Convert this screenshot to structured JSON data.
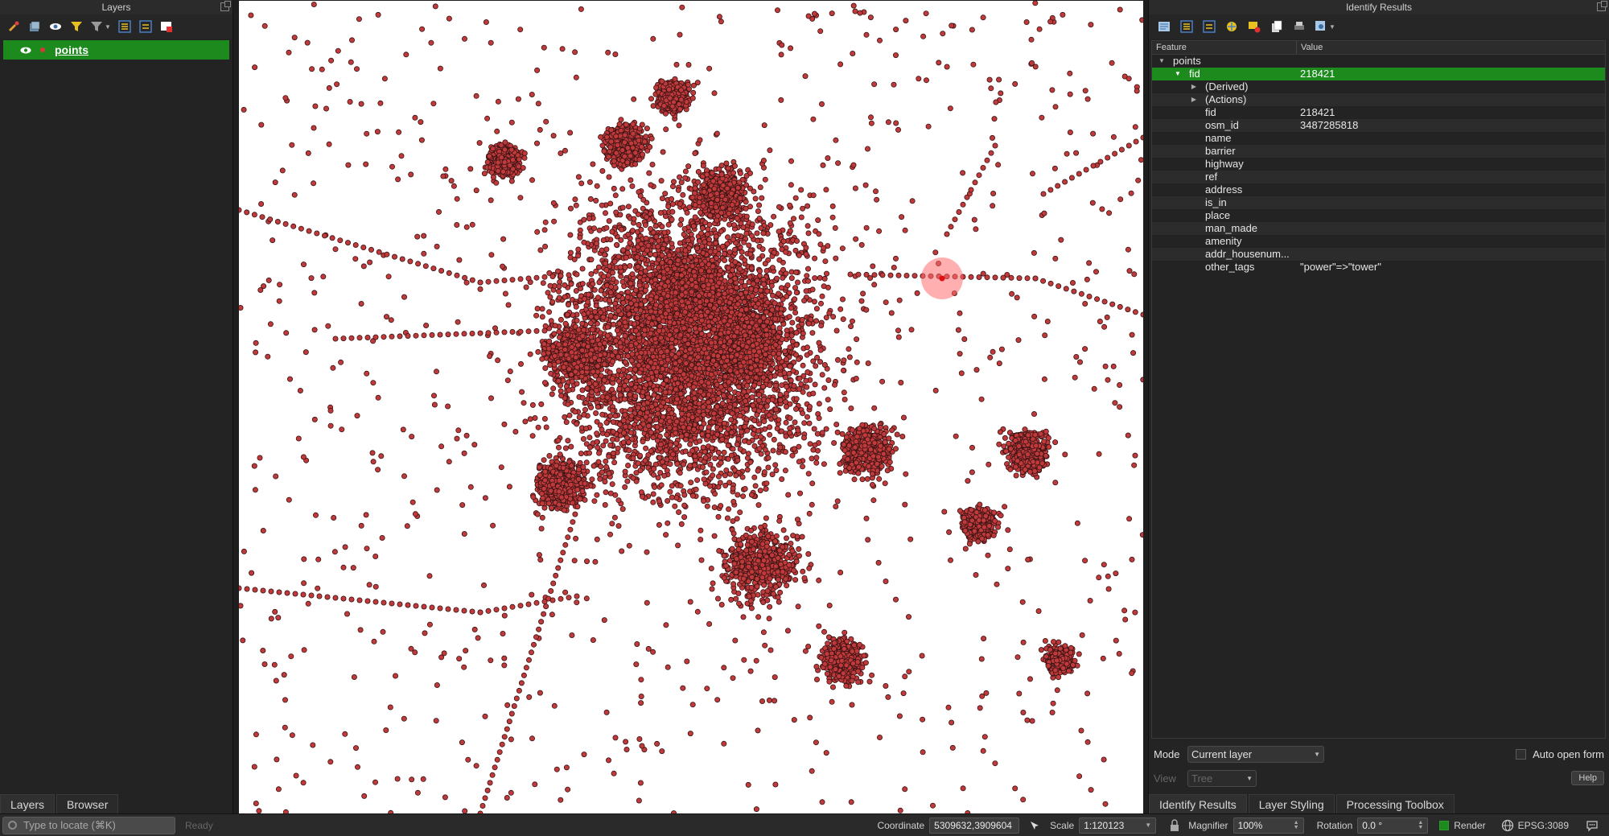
{
  "layers_panel": {
    "title": "Layers",
    "layers": [
      {
        "name": "points",
        "visible": true,
        "selected": true
      }
    ],
    "tabs": [
      "Layers",
      "Browser"
    ]
  },
  "identify_panel": {
    "title": "Identify Results",
    "header": {
      "feature": "Feature",
      "value": "Value"
    },
    "rows": [
      {
        "label": "points",
        "value": "",
        "indent": 1,
        "arrow": "down",
        "selected": false
      },
      {
        "label": "fid",
        "value": "218421",
        "indent": 2,
        "arrow": "down",
        "selected": true
      },
      {
        "label": "(Derived)",
        "value": "",
        "indent": 3,
        "arrow": "right",
        "selected": false
      },
      {
        "label": "(Actions)",
        "value": "",
        "indent": 3,
        "arrow": "right",
        "selected": false
      },
      {
        "label": "fid",
        "value": "218421",
        "indent": 3,
        "arrow": "",
        "selected": false
      },
      {
        "label": "osm_id",
        "value": "3487285818",
        "indent": 3,
        "arrow": "",
        "selected": false
      },
      {
        "label": "name",
        "value": "",
        "indent": 3,
        "arrow": "",
        "selected": false
      },
      {
        "label": "barrier",
        "value": "",
        "indent": 3,
        "arrow": "",
        "selected": false
      },
      {
        "label": "highway",
        "value": "",
        "indent": 3,
        "arrow": "",
        "selected": false
      },
      {
        "label": "ref",
        "value": "",
        "indent": 3,
        "arrow": "",
        "selected": false
      },
      {
        "label": "address",
        "value": "",
        "indent": 3,
        "arrow": "",
        "selected": false
      },
      {
        "label": "is_in",
        "value": "",
        "indent": 3,
        "arrow": "",
        "selected": false
      },
      {
        "label": "place",
        "value": "",
        "indent": 3,
        "arrow": "",
        "selected": false
      },
      {
        "label": "man_made",
        "value": "",
        "indent": 3,
        "arrow": "",
        "selected": false
      },
      {
        "label": "amenity",
        "value": "",
        "indent": 3,
        "arrow": "",
        "selected": false
      },
      {
        "label": "addr_housenum...",
        "value": "",
        "indent": 3,
        "arrow": "",
        "selected": false
      },
      {
        "label": "other_tags",
        "value": "\"power\"=>\"tower\"",
        "indent": 3,
        "arrow": "",
        "selected": false
      }
    ],
    "mode": {
      "label": "Mode",
      "value": "Current layer"
    },
    "auto_open_form": {
      "label": "Auto open form",
      "checked": false
    },
    "view": {
      "label": "View",
      "value": "Tree"
    },
    "help_label": "Help",
    "tabs": [
      "Identify Results",
      "Layer Styling",
      "Processing Toolbox"
    ]
  },
  "status_bar": {
    "locator_placeholder": "Type to locate (⌘K)",
    "message": "Ready",
    "coordinate_label": "Coordinate",
    "coordinate_value": "5309632,3909604",
    "scale_label": "Scale",
    "scale_value": "1:120123",
    "magnifier_label": "Magnifier",
    "magnifier_value": "100%",
    "rotation_label": "Rotation",
    "rotation_value": "0.0 °",
    "render_label": "Render",
    "render_checked": true,
    "crs_value": "EPSG:3089"
  },
  "map": {
    "point_color": "#c0393b",
    "point_stroke": "#3a1414",
    "highlight_color": "#ff6e6e"
  }
}
